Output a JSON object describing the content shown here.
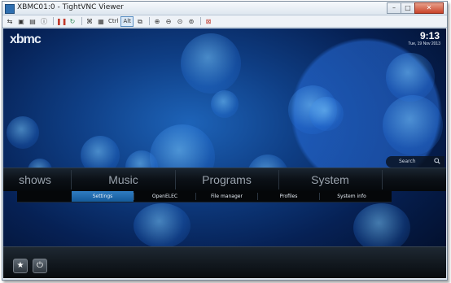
{
  "window": {
    "title": "XBMC01:0 - TightVNC Viewer",
    "controls": [
      "–",
      "□",
      "✕"
    ]
  },
  "toolbar": {
    "ctrl_label": "Ctrl",
    "alt_label": "Alt"
  },
  "xbmc": {
    "logo": "xbmc",
    "time": "9:13",
    "date": "Tue, 19 Nov 2013",
    "search_label": "Search",
    "main_menu": [
      "shows",
      "Music",
      "Programs",
      "System"
    ],
    "sub_menu": [
      "Settings",
      "OpenELEC",
      "File manager",
      "Profiles",
      "System info"
    ],
    "active_sub": "Settings"
  },
  "colors": {
    "accent": "#1e6fb5",
    "background_deep": "#062155"
  }
}
